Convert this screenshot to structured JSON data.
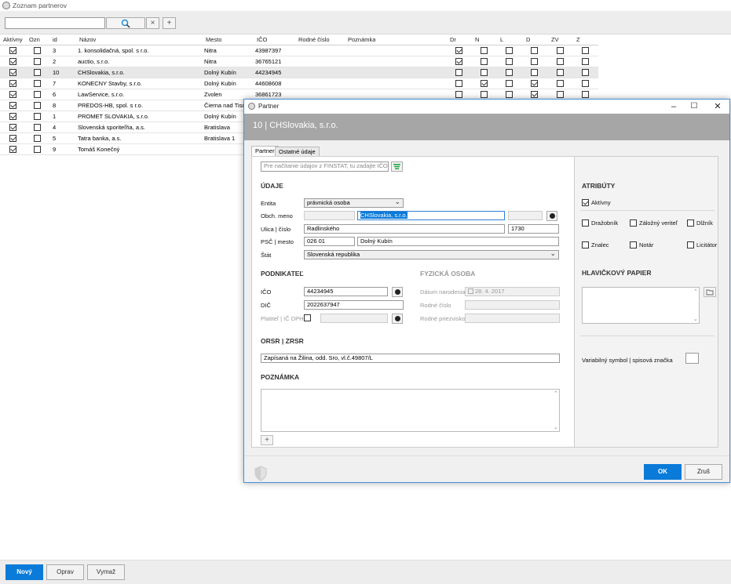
{
  "main": {
    "title": "Zoznam partnerov",
    "toolbar": {
      "search_value": "",
      "search_icon": "search-icon",
      "clear_glyph": "×",
      "add_glyph": "+"
    }
  },
  "grid": {
    "headers": [
      "Aktívny",
      "Ozn",
      "id",
      "Názov",
      "Mesto",
      "IČO",
      "Rodné číslo",
      "Poznámka",
      "Dr",
      "N",
      "L",
      "D",
      "ZV",
      "Z"
    ],
    "rows": [
      {
        "aktivny": true,
        "ozn": false,
        "id": "3",
        "nazov": "1. konsolidačná, spol. s r.o.",
        "mesto": "Nitra",
        "ico": "43987397",
        "flags": [
          true,
          false,
          false,
          false,
          false,
          false
        ],
        "selected": false
      },
      {
        "aktivny": true,
        "ozn": false,
        "id": "2",
        "nazov": "auctio, s.r.o.",
        "mesto": "Nitra",
        "ico": "36765121",
        "flags": [
          true,
          false,
          false,
          false,
          false,
          false
        ],
        "selected": false
      },
      {
        "aktivny": true,
        "ozn": false,
        "id": "10",
        "nazov": "CHSlovakia, s.r.o.",
        "mesto": "Dolný Kubín",
        "ico": "44234945",
        "flags": [
          false,
          false,
          false,
          false,
          false,
          false
        ],
        "selected": true
      },
      {
        "aktivny": true,
        "ozn": false,
        "id": "7",
        "nazov": "KONECNY Stavby, s.r.o.",
        "mesto": "Dolný Kubín",
        "ico": "44608608",
        "flags": [
          false,
          true,
          false,
          true,
          false,
          false
        ],
        "selected": false
      },
      {
        "aktivny": true,
        "ozn": false,
        "id": "6",
        "nazov": "LawService, s.r.o.",
        "mesto": "Zvolen",
        "ico": "36861723",
        "flags": [
          false,
          false,
          false,
          true,
          false,
          false
        ],
        "selected": false
      },
      {
        "aktivny": true,
        "ozn": false,
        "id": "8",
        "nazov": "PREDOS-HB, spol. s r.o.",
        "mesto": "Čierna nad Tisou",
        "ico": "",
        "flags": [
          false,
          false,
          false,
          false,
          false,
          false
        ],
        "selected": false
      },
      {
        "aktivny": true,
        "ozn": false,
        "id": "1",
        "nazov": "PROMET SLOVAKIA, s.r.o.",
        "mesto": "Dolný Kubín",
        "ico": "",
        "flags": [
          false,
          false,
          false,
          false,
          false,
          false
        ],
        "selected": false
      },
      {
        "aktivny": true,
        "ozn": false,
        "id": "4",
        "nazov": "Slovenská sporiteľňa, a.s.",
        "mesto": "Bratislava",
        "ico": "",
        "flags": [
          false,
          false,
          false,
          false,
          false,
          false
        ],
        "selected": false
      },
      {
        "aktivny": true,
        "ozn": false,
        "id": "5",
        "nazov": "Tatra banka, a.s.",
        "mesto": "Bratislava 1",
        "ico": "",
        "flags": [
          false,
          false,
          false,
          false,
          false,
          false
        ],
        "selected": false
      },
      {
        "aktivny": true,
        "ozn": false,
        "id": "9",
        "nazov": "Tomáš Konečný",
        "mesto": "",
        "ico": "",
        "flags": [
          false,
          false,
          false,
          false,
          false,
          false
        ],
        "selected": false
      }
    ]
  },
  "bottom": {
    "new_label": "Nový",
    "edit_label": "Oprav",
    "delete_label": "Vymaž"
  },
  "dialog": {
    "title": "Partner",
    "header": "10 | CHSlovakia, s.r.o.",
    "tabs": [
      "Partner",
      "Ostatné údaje"
    ],
    "finstat_placeholder": "Pre načítanie údajov z FINSTAT, tu zadajte IČO",
    "udaje": {
      "section": "ÚDAJE",
      "entita_label": "Entita",
      "entita_value": "právnická osoba",
      "obch_label": "Obch. meno",
      "obch_value": "CHSlovakia, s.r.o.",
      "ulica_label": "Ulica | číslo",
      "ulica_value": "Radlinského",
      "cislo_value": "1730",
      "psc_label": "PSČ | mesto",
      "psc_value": "026 01",
      "mesto_value": "Dolný Kubín",
      "stat_label": "Štát",
      "stat_value": "Slovenská republika"
    },
    "podnikatel": {
      "section": "PODNIKATEĽ",
      "ico_label": "IČO",
      "ico_value": "44234945",
      "dic_label": "DIČ",
      "dic_value": "2022637947",
      "dph_label": "Platiteľ | IČ DPH"
    },
    "fyzicka": {
      "section": "FYZICKÁ OSOBA",
      "datum_label": "Dátum narodenia",
      "datum_value": "28.  4. 2017",
      "rc_label": "Rodné číslo",
      "rp_label": "Rodné priezvisko"
    },
    "orsr": {
      "section": "ORSR | ZRSR",
      "value": "Zapísaná na Žilina, odd. Sro, vl.č.49807/L"
    },
    "poznamka": {
      "section": "POZNÁMKA"
    },
    "atributy": {
      "section": "ATRIBÚTY",
      "aktivny": "Aktívny",
      "drazobnik": "Dražobník",
      "zalozny": "Záložný veriteľ",
      "dlznik": "Dlžník",
      "znalec": "Znalec",
      "notar": "Notár",
      "licitator": "Licitátor"
    },
    "hlavickovy": {
      "section": "HLAVIČKOVÝ PAPIER"
    },
    "variabilny_label": "Variabilný symbol | spisová značka",
    "ok_label": "OK",
    "cancel_label": "Zruš",
    "window_controls": {
      "minimize": "–",
      "maximize": "☐",
      "close": "✕"
    }
  }
}
